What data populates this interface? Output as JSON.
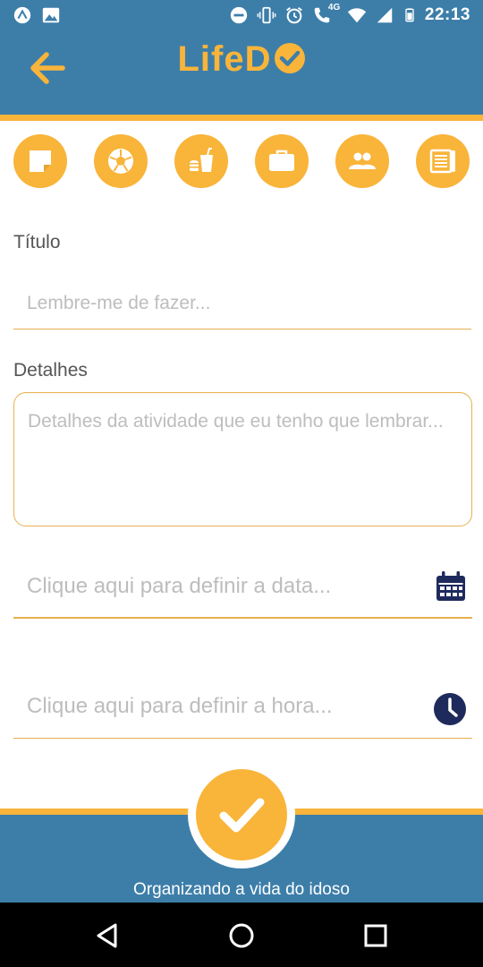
{
  "status_bar": {
    "time": "22:13",
    "network_label": "4G",
    "icons": [
      "app-notification-icon",
      "image-icon",
      "do-not-disturb-icon",
      "vibrate-icon",
      "alarm-icon",
      "wifi-calling-icon",
      "wifi-icon",
      "signal-icon",
      "battery-icon"
    ]
  },
  "app_bar": {
    "title": "LifeD",
    "back_icon": "arrow-left-icon",
    "logo_check_icon": "check-circle-icon"
  },
  "categories": [
    {
      "name": "note",
      "icon": "sticky-note-icon"
    },
    {
      "name": "sport",
      "icon": "soccer-ball-icon"
    },
    {
      "name": "food",
      "icon": "fast-food-icon"
    },
    {
      "name": "work",
      "icon": "briefcase-icon"
    },
    {
      "name": "social",
      "icon": "people-icon"
    },
    {
      "name": "news",
      "icon": "newspaper-icon"
    }
  ],
  "form": {
    "title_label": "Título",
    "title_placeholder": "Lembre-me de fazer...",
    "details_label": "Detalhes",
    "details_placeholder": "Detalhes da atividade que eu tenho que lembrar...",
    "date_placeholder": "Clique aqui para definir a data...",
    "hour_placeholder": "Clique aqui para definir a hora..."
  },
  "footer": {
    "tagline": "Organizando a vida do idoso",
    "confirm_icon": "check-icon"
  },
  "colors": {
    "primary_blue": "#3d7ea9",
    "accent_orange": "#f9b43a",
    "icon_navy": "#1f2a5c",
    "placeholder_gray": "#bdbdbd"
  }
}
